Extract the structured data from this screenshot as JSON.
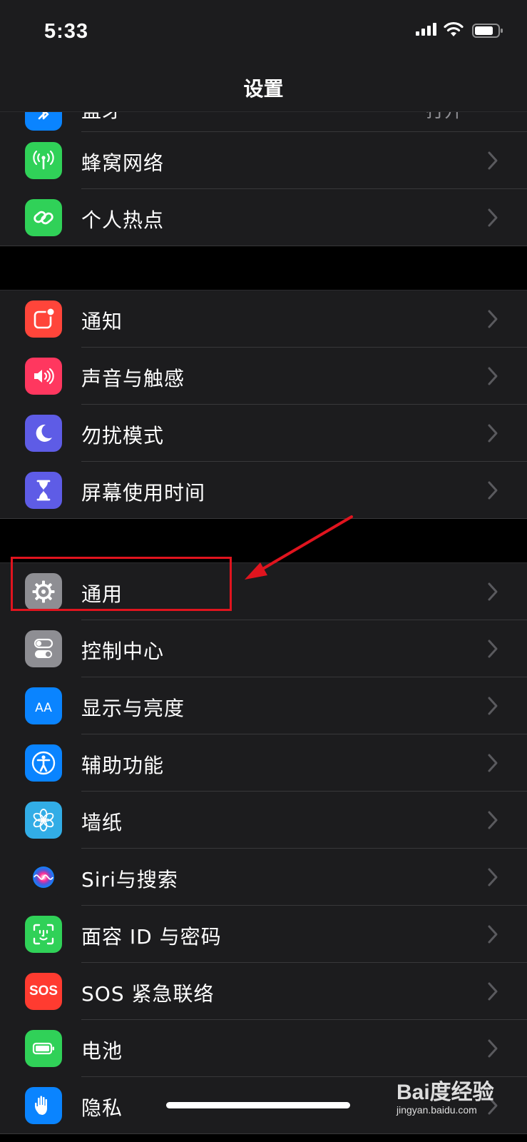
{
  "status": {
    "time": "5:33"
  },
  "nav": {
    "title": "设置"
  },
  "groups": [
    {
      "rows": [
        {
          "name": "bluetooth",
          "label": "蓝牙",
          "detail": "打开",
          "color": "#0a84ff",
          "icon": "bluetooth-icon",
          "partial": true
        },
        {
          "name": "cellular",
          "label": "蜂窝网络",
          "color": "#30d158",
          "icon": "antenna-icon"
        },
        {
          "name": "hotspot",
          "label": "个人热点",
          "color": "#30d158",
          "icon": "chain-link-icon"
        }
      ]
    },
    {
      "rows": [
        {
          "name": "notifications",
          "label": "通知",
          "color": "#ff453a",
          "icon": "notification-icon"
        },
        {
          "name": "sounds",
          "label": "声音与触感",
          "color": "#ff375f",
          "icon": "speaker-icon"
        },
        {
          "name": "do-not-disturb",
          "label": "勿扰模式",
          "color": "#5e5ce6",
          "icon": "moon-icon"
        },
        {
          "name": "screen-time",
          "label": "屏幕使用时间",
          "color": "#5e5ce6",
          "icon": "hourglass-icon"
        }
      ]
    },
    {
      "rows": [
        {
          "name": "general",
          "label": "通用",
          "color": "#8e8e93",
          "icon": "gear-icon"
        },
        {
          "name": "control-center",
          "label": "控制中心",
          "color": "#8e8e93",
          "icon": "toggle-icon"
        },
        {
          "name": "display",
          "label": "显示与亮度",
          "color": "#0a84ff",
          "icon": "aa-icon"
        },
        {
          "name": "accessibility",
          "label": "辅助功能",
          "color": "#0a84ff",
          "icon": "accessibility-icon"
        },
        {
          "name": "wallpaper",
          "label": "墙纸",
          "color": "#32ade6",
          "icon": "flower-icon"
        },
        {
          "name": "siri",
          "label": "Siri与搜索",
          "color": "#1c1c1e",
          "icon": "siri-icon"
        },
        {
          "name": "face-id",
          "label": "面容 ID 与密码",
          "color": "#30d158",
          "icon": "face-id-icon"
        },
        {
          "name": "sos",
          "label": "SOS 紧急联络",
          "color": "#ff3b30",
          "icon": "sos-icon",
          "icon_text": "SOS"
        },
        {
          "name": "battery",
          "label": "电池",
          "color": "#30d158",
          "icon": "battery-icon"
        },
        {
          "name": "privacy",
          "label": "隐私",
          "color": "#0a84ff",
          "icon": "hand-icon"
        }
      ]
    }
  ],
  "watermark": {
    "brand": "Bai度经验",
    "url": "jingyan.baidu.com"
  }
}
